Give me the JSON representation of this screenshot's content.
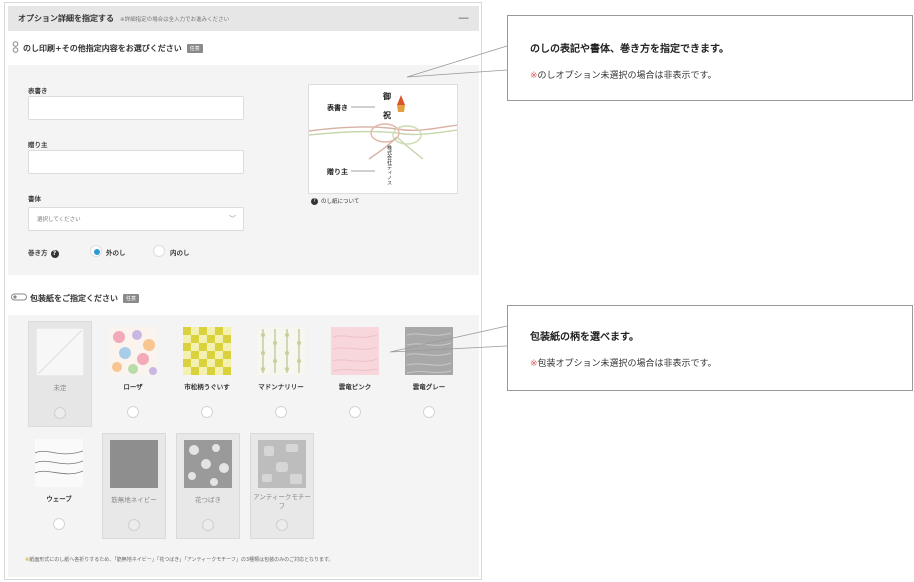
{
  "header": {
    "title": "オプション詳細を指定する",
    "note": "※詳細指定の場合は全入力でお進みください",
    "collapse_glyph": "—"
  },
  "noshi": {
    "title": "のし印刷+その他指定内容をお選びください",
    "badge": "任意",
    "fields": {
      "omotegaki_label": "表書き",
      "okurinushi_label": "贈り主",
      "font_label": "書体",
      "font_select_value": "選択してください"
    },
    "wrap": {
      "label": "巻き方",
      "options": [
        "外のし",
        "内のし"
      ],
      "selected_index": 0
    },
    "preview": {
      "omotegaki_text": "表書き",
      "okurinushi_text": "贈り主",
      "title_chars": [
        "御",
        "祝"
      ],
      "company_text": "株式会社ディノス"
    },
    "help_link": "のし紙について"
  },
  "wrapping": {
    "title": "包装紙をご指定ください",
    "badge": "任意",
    "items": [
      {
        "label": "未定",
        "state": "selected"
      },
      {
        "label": "ローザ",
        "state": "normal"
      },
      {
        "label": "市松柄うぐいす",
        "state": "normal"
      },
      {
        "label": "マドンナリリー",
        "state": "normal"
      },
      {
        "label": "雲竜ピンク",
        "state": "normal"
      },
      {
        "label": "雲竜グレー",
        "state": "normal"
      },
      {
        "label": "ウェーブ",
        "state": "normal"
      },
      {
        "label": "筋無地ネイビー",
        "state": "disabled"
      },
      {
        "label": "花つばき",
        "state": "disabled"
      },
      {
        "label": "アンティークモチーフ",
        "state": "disabled"
      }
    ],
    "footnote_mark": "※",
    "footnote": "紙面形式にのし紙へ各折りするため、「筋無地ネイビー」「花つばき」「アンティークモチーフ」の3種類は包装のみのご対応となります。"
  },
  "callouts": [
    {
      "title": "のしの表記や書体、巻き方を指定できます。",
      "note_mark": "※",
      "note": "のしオプション未選択の場合は非表示です。"
    },
    {
      "title": "包装紙の柄を選べます。",
      "note_mark": "※",
      "note": "包装オプション未選択の場合は非表示です。"
    }
  ],
  "colors": {
    "accent_radio": "#2a9ad6",
    "panel_bg": "#f4f4f4",
    "header_bg": "#e6e6e6",
    "note_mark": "#e06060",
    "footnote_mark": "#d9a000",
    "mizuhiki_red": "#d9542b"
  },
  "icons": {
    "noshi_section": "ribbon-knot-icon",
    "wrapping_section": "wrapping-roll-icon",
    "help": "question-circle-icon",
    "select": "chevron-down-icon"
  }
}
